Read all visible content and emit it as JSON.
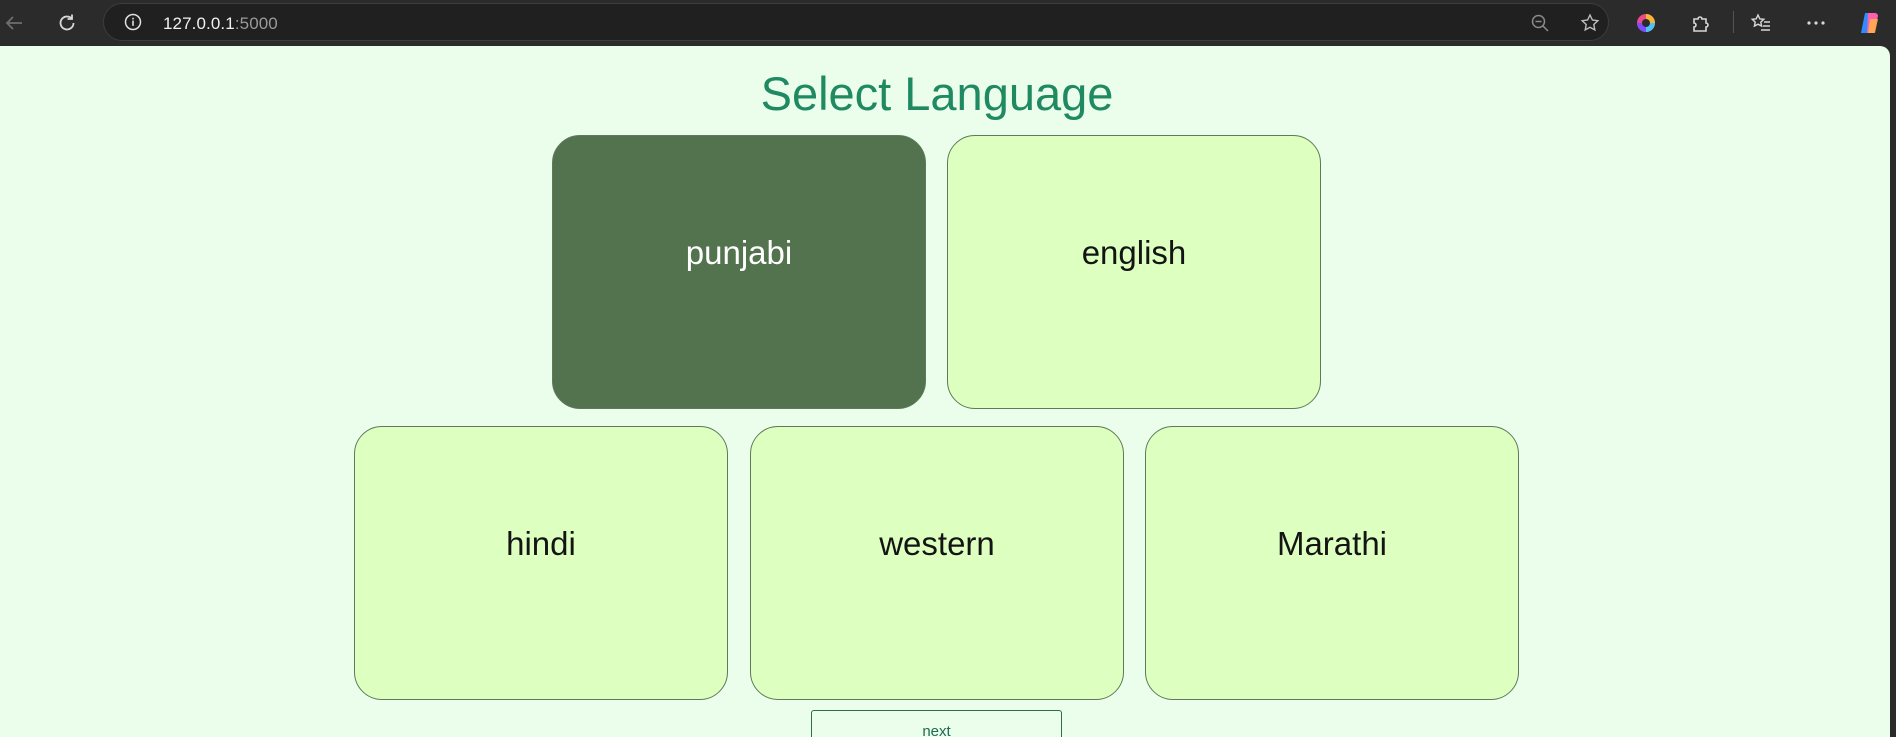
{
  "browser": {
    "url_host": "127.0.0.1",
    "url_port": ":5000",
    "icons": {
      "back": "back-arrow-icon",
      "reload": "reload-icon",
      "info": "info-icon",
      "zoom": "zoom-out-icon",
      "favorite": "star-icon",
      "colors": "color-wheel-icon",
      "extensions": "puzzle-icon",
      "favorites": "favorites-list-icon",
      "menu": "more-dots-icon",
      "copilot": "copilot-icon"
    }
  },
  "page": {
    "title": "Select Language",
    "languages": [
      {
        "label": "punjabi",
        "selected": true
      },
      {
        "label": "english",
        "selected": false
      },
      {
        "label": "hindi",
        "selected": false
      },
      {
        "label": "western",
        "selected": false
      },
      {
        "label": "Marathi",
        "selected": false
      }
    ],
    "next_label": "next"
  },
  "colors": {
    "page_background": "#ebfeeb",
    "title": "#1f8a62",
    "card": "#ddffbf",
    "card_selected": "#52734d"
  }
}
